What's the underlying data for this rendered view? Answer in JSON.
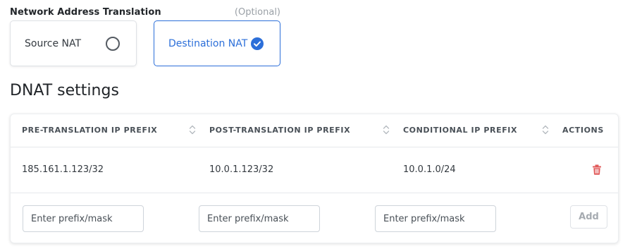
{
  "nat": {
    "label": "Network Address Translation",
    "optional": "(Optional)",
    "options": [
      {
        "label": "Source NAT",
        "selected": false
      },
      {
        "label": "Destination NAT",
        "selected": true
      }
    ]
  },
  "section": {
    "title": "DNAT settings"
  },
  "table": {
    "columns": [
      "PRE-TRANSLATION IP PREFIX",
      "POST-TRANSLATION IP PREFIX",
      "CONDITIONAL IP PREFIX",
      "ACTIONS"
    ],
    "rows": [
      {
        "pre": "185.161.1.123/32",
        "post": "10.0.1.123/32",
        "conditional": "10.0.1.0/24"
      }
    ],
    "new_row": {
      "pre_placeholder": "Enter prefix/mask",
      "post_placeholder": "Enter prefix/mask",
      "conditional_placeholder": "Enter prefix/mask",
      "add_label": "Add"
    }
  },
  "colors": {
    "accent": "#2c6fd9",
    "delete": "#e05a5a"
  },
  "icons": {
    "radio_empty": "radio-unchecked-icon",
    "radio_checked": "check-circle-icon",
    "sort": "sort-icon",
    "delete": "trash-icon"
  }
}
